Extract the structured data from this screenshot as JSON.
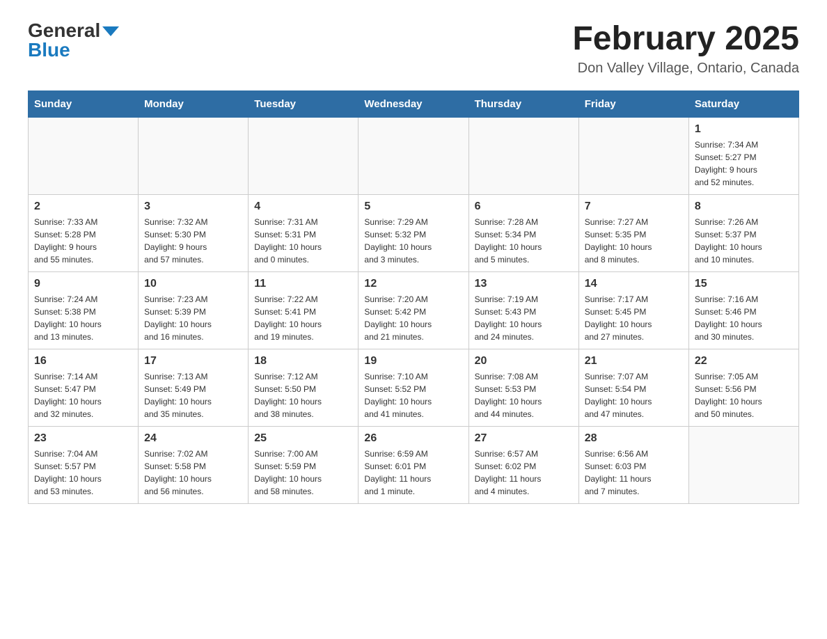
{
  "header": {
    "title": "February 2025",
    "location": "Don Valley Village, Ontario, Canada",
    "logo_general": "General",
    "logo_blue": "Blue"
  },
  "days_of_week": [
    "Sunday",
    "Monday",
    "Tuesday",
    "Wednesday",
    "Thursday",
    "Friday",
    "Saturday"
  ],
  "weeks": [
    [
      {
        "day": "",
        "info": ""
      },
      {
        "day": "",
        "info": ""
      },
      {
        "day": "",
        "info": ""
      },
      {
        "day": "",
        "info": ""
      },
      {
        "day": "",
        "info": ""
      },
      {
        "day": "",
        "info": ""
      },
      {
        "day": "1",
        "info": "Sunrise: 7:34 AM\nSunset: 5:27 PM\nDaylight: 9 hours\nand 52 minutes."
      }
    ],
    [
      {
        "day": "2",
        "info": "Sunrise: 7:33 AM\nSunset: 5:28 PM\nDaylight: 9 hours\nand 55 minutes."
      },
      {
        "day": "3",
        "info": "Sunrise: 7:32 AM\nSunset: 5:30 PM\nDaylight: 9 hours\nand 57 minutes."
      },
      {
        "day": "4",
        "info": "Sunrise: 7:31 AM\nSunset: 5:31 PM\nDaylight: 10 hours\nand 0 minutes."
      },
      {
        "day": "5",
        "info": "Sunrise: 7:29 AM\nSunset: 5:32 PM\nDaylight: 10 hours\nand 3 minutes."
      },
      {
        "day": "6",
        "info": "Sunrise: 7:28 AM\nSunset: 5:34 PM\nDaylight: 10 hours\nand 5 minutes."
      },
      {
        "day": "7",
        "info": "Sunrise: 7:27 AM\nSunset: 5:35 PM\nDaylight: 10 hours\nand 8 minutes."
      },
      {
        "day": "8",
        "info": "Sunrise: 7:26 AM\nSunset: 5:37 PM\nDaylight: 10 hours\nand 10 minutes."
      }
    ],
    [
      {
        "day": "9",
        "info": "Sunrise: 7:24 AM\nSunset: 5:38 PM\nDaylight: 10 hours\nand 13 minutes."
      },
      {
        "day": "10",
        "info": "Sunrise: 7:23 AM\nSunset: 5:39 PM\nDaylight: 10 hours\nand 16 minutes."
      },
      {
        "day": "11",
        "info": "Sunrise: 7:22 AM\nSunset: 5:41 PM\nDaylight: 10 hours\nand 19 minutes."
      },
      {
        "day": "12",
        "info": "Sunrise: 7:20 AM\nSunset: 5:42 PM\nDaylight: 10 hours\nand 21 minutes."
      },
      {
        "day": "13",
        "info": "Sunrise: 7:19 AM\nSunset: 5:43 PM\nDaylight: 10 hours\nand 24 minutes."
      },
      {
        "day": "14",
        "info": "Sunrise: 7:17 AM\nSunset: 5:45 PM\nDaylight: 10 hours\nand 27 minutes."
      },
      {
        "day": "15",
        "info": "Sunrise: 7:16 AM\nSunset: 5:46 PM\nDaylight: 10 hours\nand 30 minutes."
      }
    ],
    [
      {
        "day": "16",
        "info": "Sunrise: 7:14 AM\nSunset: 5:47 PM\nDaylight: 10 hours\nand 32 minutes."
      },
      {
        "day": "17",
        "info": "Sunrise: 7:13 AM\nSunset: 5:49 PM\nDaylight: 10 hours\nand 35 minutes."
      },
      {
        "day": "18",
        "info": "Sunrise: 7:12 AM\nSunset: 5:50 PM\nDaylight: 10 hours\nand 38 minutes."
      },
      {
        "day": "19",
        "info": "Sunrise: 7:10 AM\nSunset: 5:52 PM\nDaylight: 10 hours\nand 41 minutes."
      },
      {
        "day": "20",
        "info": "Sunrise: 7:08 AM\nSunset: 5:53 PM\nDaylight: 10 hours\nand 44 minutes."
      },
      {
        "day": "21",
        "info": "Sunrise: 7:07 AM\nSunset: 5:54 PM\nDaylight: 10 hours\nand 47 minutes."
      },
      {
        "day": "22",
        "info": "Sunrise: 7:05 AM\nSunset: 5:56 PM\nDaylight: 10 hours\nand 50 minutes."
      }
    ],
    [
      {
        "day": "23",
        "info": "Sunrise: 7:04 AM\nSunset: 5:57 PM\nDaylight: 10 hours\nand 53 minutes."
      },
      {
        "day": "24",
        "info": "Sunrise: 7:02 AM\nSunset: 5:58 PM\nDaylight: 10 hours\nand 56 minutes."
      },
      {
        "day": "25",
        "info": "Sunrise: 7:00 AM\nSunset: 5:59 PM\nDaylight: 10 hours\nand 58 minutes."
      },
      {
        "day": "26",
        "info": "Sunrise: 6:59 AM\nSunset: 6:01 PM\nDaylight: 11 hours\nand 1 minute."
      },
      {
        "day": "27",
        "info": "Sunrise: 6:57 AM\nSunset: 6:02 PM\nDaylight: 11 hours\nand 4 minutes."
      },
      {
        "day": "28",
        "info": "Sunrise: 6:56 AM\nSunset: 6:03 PM\nDaylight: 11 hours\nand 7 minutes."
      },
      {
        "day": "",
        "info": ""
      }
    ]
  ]
}
